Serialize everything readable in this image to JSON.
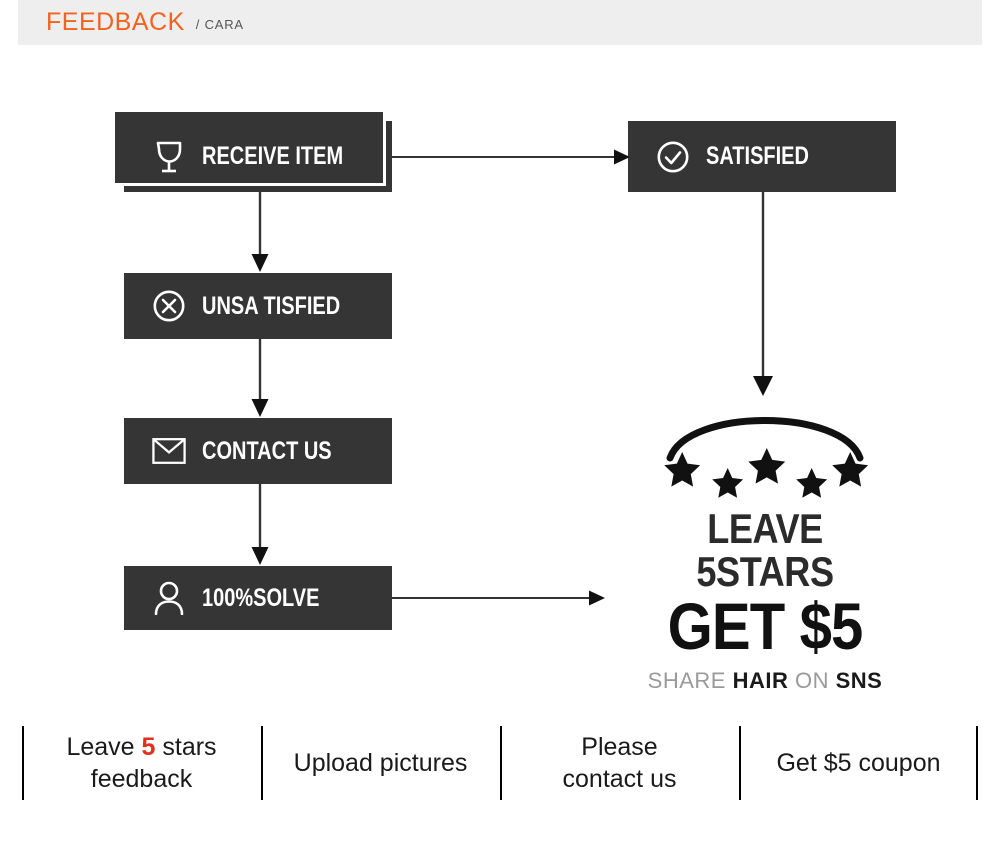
{
  "header": {
    "title": "FEEDBACK",
    "subtitle": "/ CARA",
    "accent_color": "#f4621f",
    "subtitle_color": "#555555",
    "bar_color": "#eeeeee"
  },
  "theme": {
    "box_fill": "#353535",
    "box_text": "#ffffff",
    "connector_color": "#333333",
    "highlight_red": "#e03020"
  },
  "flow": {
    "boxes": [
      {
        "id": "receive",
        "label": "RECEIVE ITEM",
        "icon": "wine-glass-icon",
        "stacked": true
      },
      {
        "id": "satisfied",
        "label": "SATISFIED",
        "icon": "check-circle-icon",
        "stacked": false
      },
      {
        "id": "unsatisfied",
        "label": "UNSA TISFIED",
        "icon": "x-circle-icon",
        "stacked": false
      },
      {
        "id": "contact",
        "label": "CONTACT US",
        "icon": "envelope-icon",
        "stacked": false
      },
      {
        "id": "solve",
        "label": "100%SOLVE",
        "icon": "user-icon",
        "stacked": false
      }
    ],
    "connectors": [
      {
        "from": "receive",
        "to": "satisfied",
        "direction": "right"
      },
      {
        "from": "receive",
        "to": "unsatisfied",
        "direction": "down"
      },
      {
        "from": "unsatisfied",
        "to": "contact",
        "direction": "down"
      },
      {
        "from": "contact",
        "to": "solve",
        "direction": "down"
      },
      {
        "from": "solve",
        "to": "reward",
        "direction": "right"
      },
      {
        "from": "satisfied",
        "to": "reward",
        "direction": "down"
      }
    ]
  },
  "reward": {
    "stars_icon": "five-stars-arc-icon",
    "star_count": 5,
    "line1": "LEAVE 5STARS",
    "line2": "GET $5",
    "line3_parts": [
      {
        "text": "SHARE ",
        "emphasis": false
      },
      {
        "text": "HAIR",
        "emphasis": true
      },
      {
        "text": " ON ",
        "emphasis": false
      },
      {
        "text": "SNS",
        "emphasis": true
      }
    ],
    "line3_plain": "SHARE HAIR ON SNS"
  },
  "footer": {
    "captions": [
      {
        "id": "leave-stars",
        "pre": "Leave ",
        "highlight": "5",
        "post": " stars",
        "line2": "feedback"
      },
      {
        "id": "upload",
        "pre": "Upload pictures",
        "highlight": "",
        "post": "",
        "line2": ""
      },
      {
        "id": "contact",
        "pre": "Please",
        "highlight": "",
        "post": "",
        "line2": "contact us"
      },
      {
        "id": "coupon",
        "pre": "Get $5 coupon",
        "highlight": "",
        "post": "",
        "line2": ""
      }
    ]
  }
}
